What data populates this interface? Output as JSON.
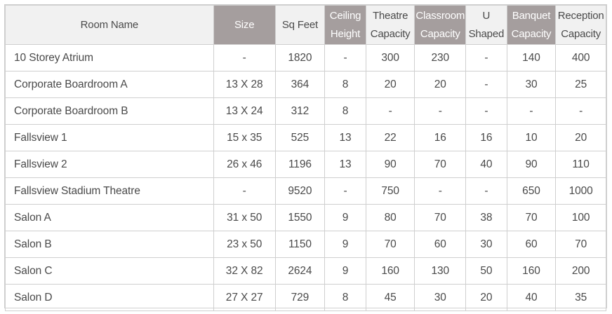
{
  "table": {
    "headers": [
      {
        "key": "room",
        "lines": [
          "Room Name"
        ],
        "dark": false
      },
      {
        "key": "size",
        "lines": [
          "Size"
        ],
        "dark": true
      },
      {
        "key": "sqft",
        "lines": [
          "Sq Feet"
        ],
        "dark": false
      },
      {
        "key": "ceiling",
        "lines": [
          "Ceiling",
          "Height"
        ],
        "dark": true
      },
      {
        "key": "theatre",
        "lines": [
          "Theatre",
          "Capacity"
        ],
        "dark": false
      },
      {
        "key": "classroom",
        "lines": [
          "Classroom",
          "Capacity"
        ],
        "dark": true
      },
      {
        "key": "ushaped",
        "lines": [
          "U",
          "Shaped"
        ],
        "dark": false
      },
      {
        "key": "banquet",
        "lines": [
          "Banquet",
          "Capacity"
        ],
        "dark": true
      },
      {
        "key": "reception",
        "lines": [
          "Reception",
          "Capacity"
        ],
        "dark": false
      }
    ],
    "rows": [
      [
        "10 Storey Atrium",
        "-",
        "1820",
        "-",
        "300",
        "230",
        "-",
        "140",
        "400"
      ],
      [
        "Corporate Boardroom A",
        "13 X 28",
        "364",
        "8",
        "20",
        "20",
        "-",
        "30",
        "25"
      ],
      [
        "Corporate Boardroom B",
        "13 X 24",
        "312",
        "8",
        "-",
        "-",
        "-",
        "-",
        "-"
      ],
      [
        "Fallsview 1",
        "15 x 35",
        "525",
        "13",
        "22",
        "16",
        "16",
        "10",
        "20"
      ],
      [
        "Fallsview 2",
        "26 x 46",
        "1196",
        "13",
        "90",
        "70",
        "40",
        "90",
        "110"
      ],
      [
        "Fallsview Stadium Theatre",
        "-",
        "9520",
        "-",
        "750",
        "-",
        "-",
        "650",
        "1000"
      ],
      [
        "Salon A",
        "31 x 50",
        "1550",
        "9",
        "80",
        "70",
        "38",
        "70",
        "100"
      ],
      [
        "Salon B",
        "23 x 50",
        "1150",
        "9",
        "70",
        "60",
        "30",
        "60",
        "70"
      ],
      [
        "Salon C",
        "32 X 82",
        "2624",
        "9",
        "160",
        "130",
        "50",
        "160",
        "200"
      ],
      [
        "Salon D",
        "27 X 27",
        "729",
        "8",
        "45",
        "30",
        "20",
        "40",
        "35"
      ]
    ]
  },
  "colors": {
    "header_light": "#f1f1f1",
    "header_dark": "#a59e9e",
    "border": "#cfcfcf",
    "text": "#4a4a4a"
  }
}
